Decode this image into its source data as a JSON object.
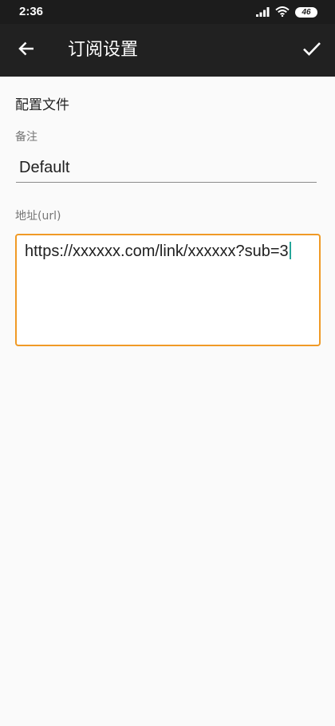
{
  "status_bar": {
    "time": "2:36",
    "signal_icon": "cellular-signal-icon",
    "wifi_icon": "wifi-icon",
    "battery_level": "46"
  },
  "toolbar": {
    "back_icon": "arrow-left-icon",
    "title": "订阅设置",
    "confirm_icon": "checkmark-icon"
  },
  "form": {
    "section_title": "配置文件",
    "remark_label": "备注",
    "remark_value": "Default",
    "url_label": "地址(url)",
    "url_value": "https://xxxxxx.com/link/xxxxxx?sub=3"
  },
  "colors": {
    "toolbar_bg": "#212121",
    "status_bar_bg": "#1c1c1c",
    "focus_border": "#f09a26",
    "caret": "#26a69a"
  }
}
